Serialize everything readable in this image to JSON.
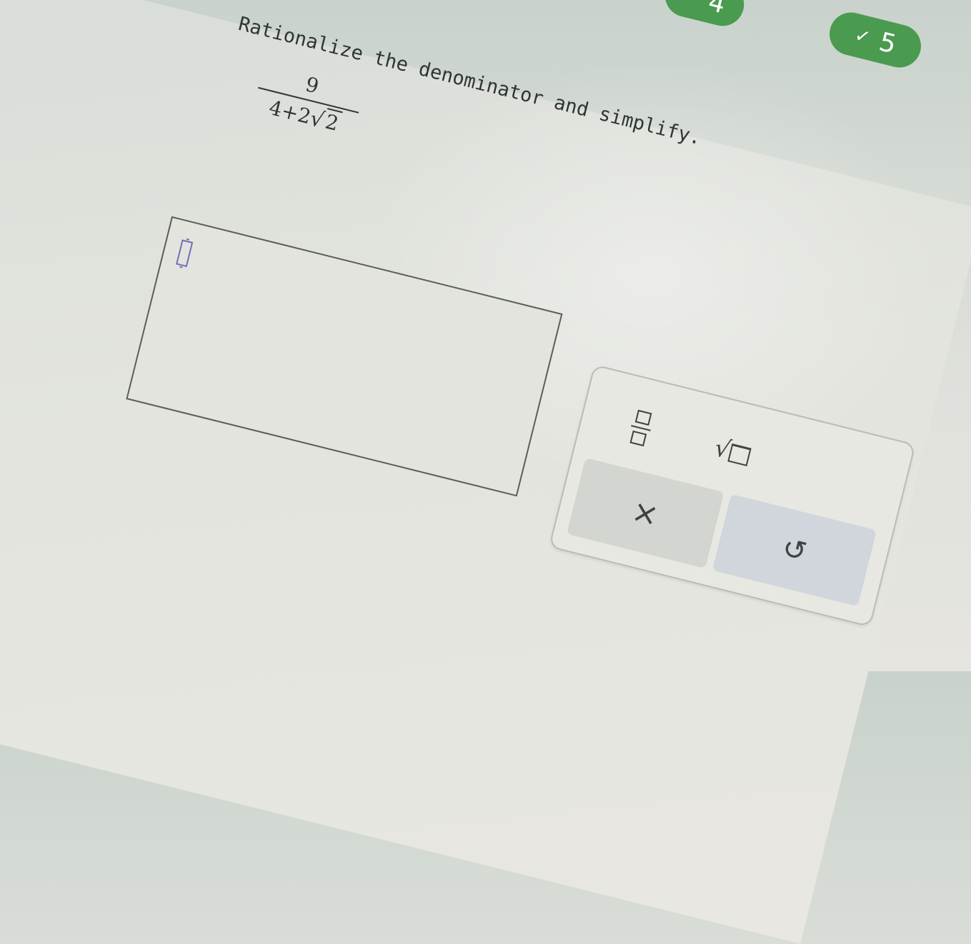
{
  "question": {
    "prompt": "Rationalize the denominator and simplify.",
    "expression": {
      "numerator": "9",
      "denominator_prefix": "4+2",
      "radicand": "2"
    }
  },
  "answer_box": {
    "value": ""
  },
  "keypad": {
    "fraction_icon": "fraction-template-icon",
    "sqrt_icon": "square-root-template-icon",
    "clear_label": "×",
    "undo_label": "↺"
  },
  "progress": {
    "steps": [
      {
        "label": "4",
        "status": "complete"
      },
      {
        "label": "5",
        "status": "complete"
      }
    ],
    "check_glyph": "✓"
  },
  "colors": {
    "badge_green": "#4a9a4f",
    "cursor_blue": "#6a73b8",
    "text": "#2f3532"
  }
}
